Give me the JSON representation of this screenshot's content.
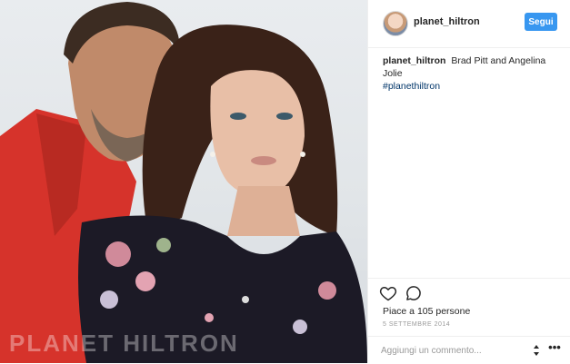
{
  "post": {
    "watermark": "PLANET HILTRON"
  },
  "header": {
    "username": "planet_hiltron",
    "follow_label": "Segui"
  },
  "caption": {
    "username": "planet_hiltron",
    "text": "Brad Pitt and Angelina Jolie",
    "hashtag": "#planethiltron"
  },
  "engagement": {
    "likes_text": "Piace a 105 persone",
    "date": "5 SETTEMBRE 2014"
  },
  "comment_box": {
    "placeholder": "Aggiungi un commento..."
  },
  "icons": {
    "like": "heart-icon",
    "comment": "comment-bubble-icon",
    "sort": "sort-arrows-icon",
    "more": "more-options-icon"
  },
  "colors": {
    "follow_button": "#3897f0",
    "hashtag": "#003569",
    "text": "#262626",
    "muted": "#999999"
  }
}
